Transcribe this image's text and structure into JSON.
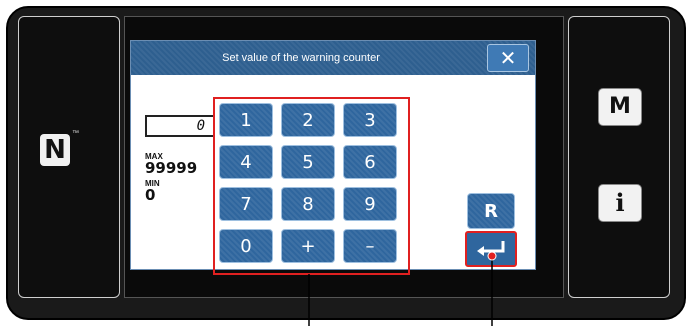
{
  "dialog": {
    "title": "Set value of the warning counter",
    "close_label": "✕",
    "current_value": "0",
    "max_label": "MAX",
    "max_value": "99999",
    "min_label": "MIN",
    "min_value": "0"
  },
  "keypad": {
    "keys": [
      "1",
      "2",
      "3",
      "4",
      "5",
      "6",
      "7",
      "8",
      "9",
      "0",
      "+",
      "–"
    ]
  },
  "buttons": {
    "reset_label": "R",
    "menu_label": "M",
    "info_label": "i"
  },
  "nfc": {
    "logo": "N",
    "tm": "™"
  }
}
